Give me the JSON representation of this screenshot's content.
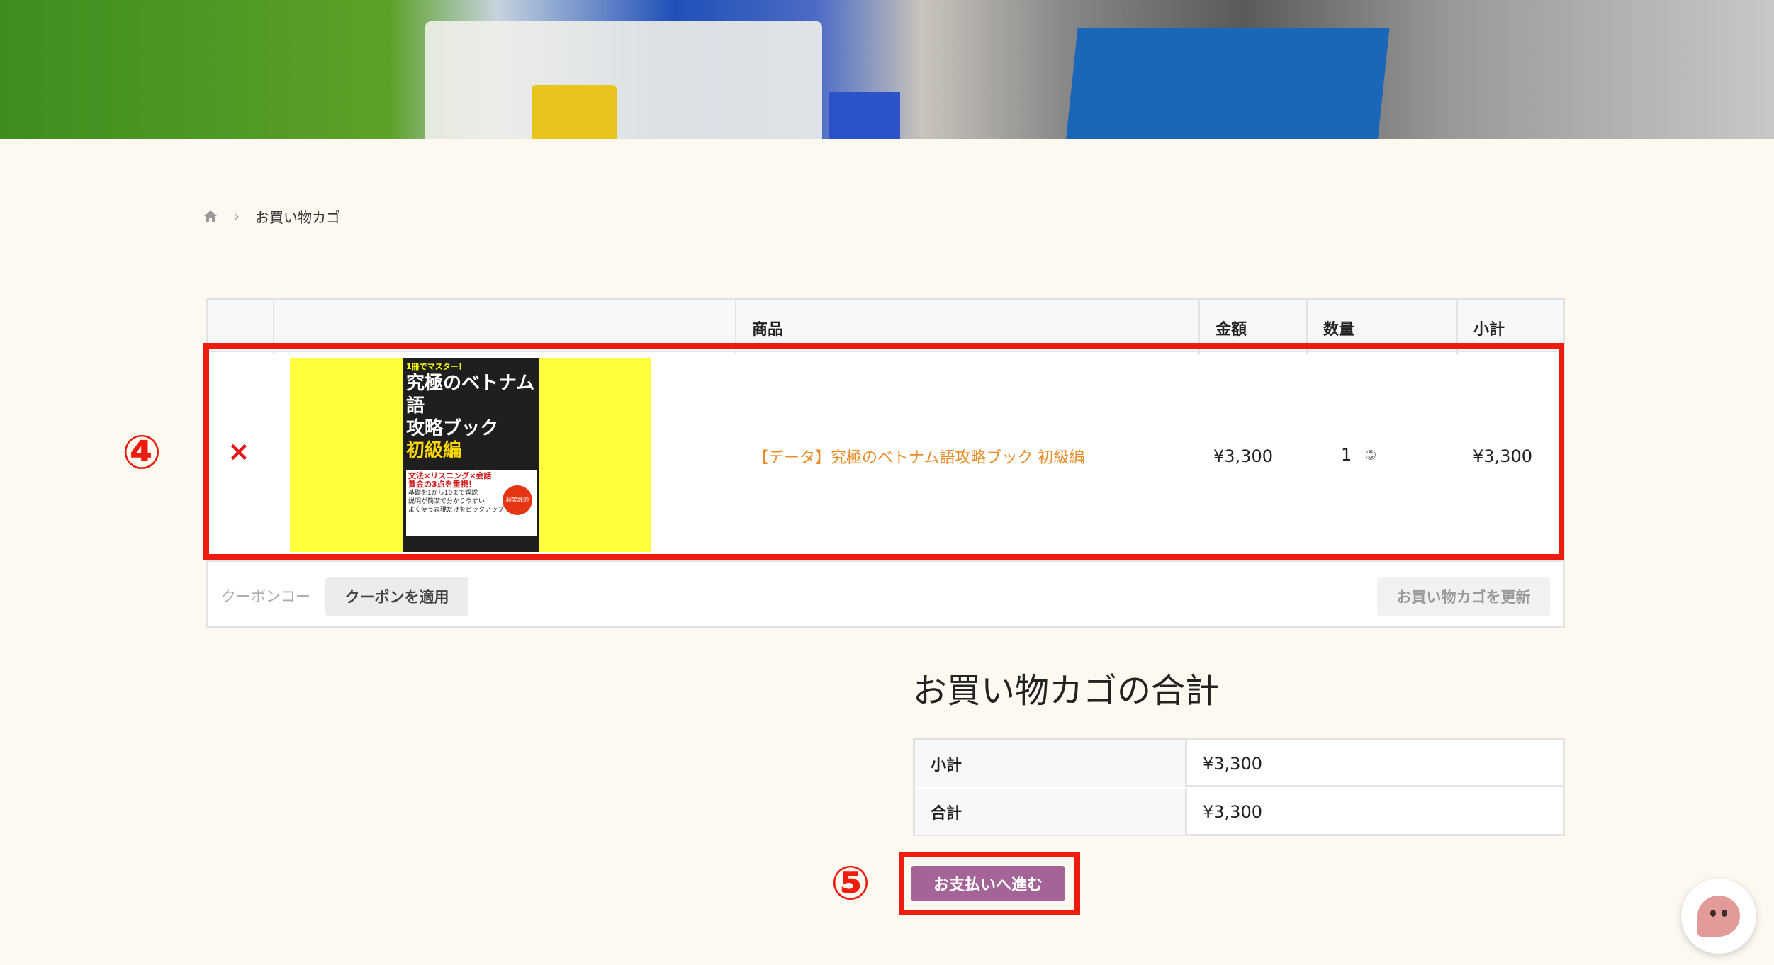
{
  "breadcrumb": {
    "home_icon": "home-icon",
    "separator": "›",
    "current": "お買い物カゴ"
  },
  "cart": {
    "headers": [
      "",
      "",
      "商品",
      "金額",
      "数量",
      "小計"
    ],
    "item": {
      "remove_symbol": "×",
      "book_cover": {
        "tag": "1冊でマスター！",
        "title_line1": "究極のベトナム語",
        "title_line2": "攻略ブック",
        "subtitle": "初級編",
        "panel_headline": "文法×リスニング×会話",
        "panel_headline2": "黄金の3点を重視！",
        "bullet1": "基礎を1から10まで解説",
        "bullet2": "説明が簡潔で分かりやすい",
        "bullet3": "よく使う表現だけをピックアップ",
        "badge": "超実践的"
      },
      "product_name": "【データ】究極のベトナム語攻略ブック 初級編",
      "price": "¥3,300",
      "quantity": "1",
      "subtotal": "¥3,300"
    },
    "coupon_placeholder": "クーポンコー",
    "apply_coupon": "クーポンを適用",
    "update_cart": "お買い物カゴを更新"
  },
  "annotations": {
    "marker4": "④",
    "marker5": "⑤",
    "color": "#ee1b0f"
  },
  "totals": {
    "title": "お買い物カゴの合計",
    "rows": [
      {
        "label": "小計",
        "value": "¥3,300"
      },
      {
        "label": "合計",
        "value": "¥3,300"
      }
    ],
    "checkout": "お支払いへ進む"
  },
  "colors": {
    "checkout_bg": "#a46497",
    "product_link": "#e98b26",
    "remove": "#e0191b"
  },
  "chat": {
    "icon": "chat-face-icon"
  }
}
